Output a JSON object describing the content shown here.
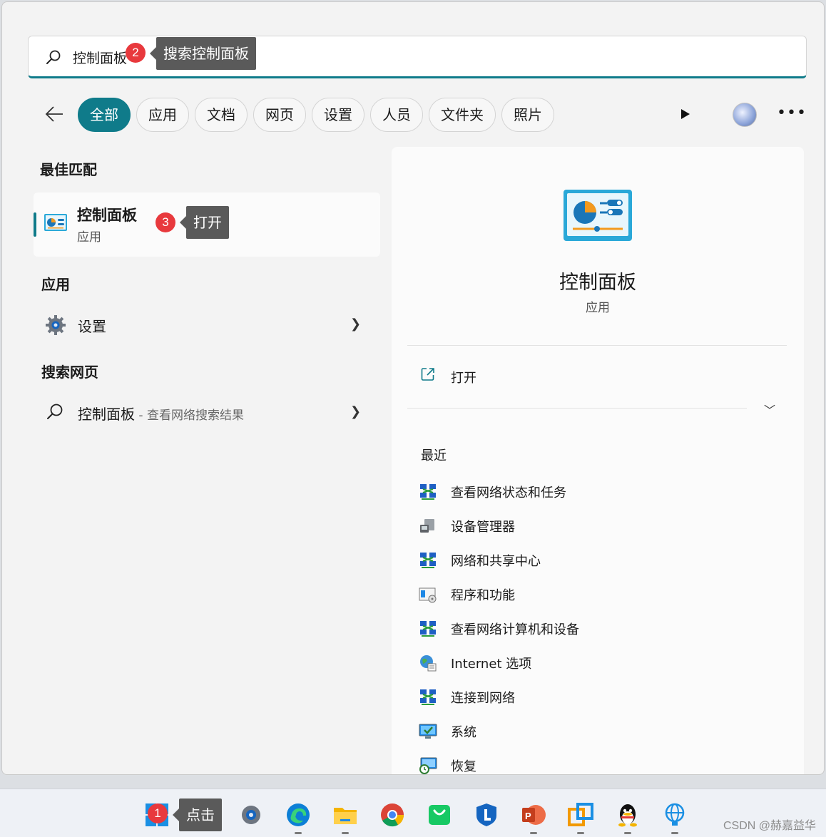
{
  "search": {
    "query": "控制面板",
    "step_badge": "2",
    "step_tip": "搜索控制面板"
  },
  "filters": {
    "items": [
      "全部",
      "应用",
      "文档",
      "网页",
      "设置",
      "人员",
      "文件夹",
      "照片"
    ],
    "active_index": 0
  },
  "best_match": {
    "heading": "最佳匹配",
    "name": "控制面板",
    "type": "应用",
    "step_badge": "3",
    "step_tip": "打开"
  },
  "apps": {
    "heading": "应用",
    "items": [
      {
        "label": "设置",
        "icon": "gear-icon"
      }
    ]
  },
  "web": {
    "heading": "搜索网页",
    "query": "控制面板",
    "suffix": " - 查看网络搜索结果"
  },
  "detail": {
    "title": "控制面板",
    "type": "应用",
    "open_label": "打开",
    "recent_heading": "最近",
    "recent": [
      {
        "label": "查看网络状态和任务",
        "icon": "network-icon"
      },
      {
        "label": "设备管理器",
        "icon": "device-manager-icon"
      },
      {
        "label": "网络和共享中心",
        "icon": "network-icon"
      },
      {
        "label": "程序和功能",
        "icon": "programs-icon"
      },
      {
        "label": "查看网络计算机和设备",
        "icon": "network-icon"
      },
      {
        "label": "Internet 选项",
        "icon": "internet-options-icon"
      },
      {
        "label": "连接到网络",
        "icon": "network-icon"
      },
      {
        "label": "系统",
        "icon": "system-icon"
      },
      {
        "label": "恢复",
        "icon": "recovery-icon"
      }
    ]
  },
  "taskbar": {
    "step_badge": "1",
    "step_tip": "点击",
    "apps": [
      "start-icon",
      "task-view-icon",
      "settings-icon",
      "edge-icon",
      "file-explorer-icon",
      "chrome-icon",
      "store-icon",
      "lenovo-icon",
      "powerpoint-icon",
      "remote-icon",
      "qq-icon",
      "network-globe-icon"
    ]
  },
  "watermark": "CSDN @赫嘉益华",
  "colors": {
    "accent": "#0f7b8a",
    "badge": "#e8393d",
    "tooltip": "#5a5a5a"
  }
}
